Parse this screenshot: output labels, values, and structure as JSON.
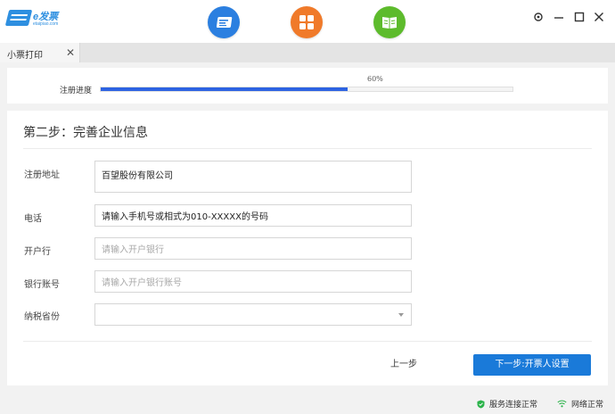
{
  "app": {
    "logo_text": "e发票",
    "logo_sub": "etaipiao.com",
    "icons": [
      "invoice-card-icon",
      "apps-grid-icon",
      "book-icon"
    ],
    "colors": {
      "accent": "#1a7ad9",
      "progress": "#2d63e2",
      "icon_blue": "#2b7fe0",
      "icon_orange": "#f07a2a",
      "icon_green": "#5dbb2c",
      "status_ok": "#2bb34a"
    }
  },
  "tabs": [
    {
      "label": "小票打印",
      "close": "✕"
    }
  ],
  "progress": {
    "label": "注册进度",
    "percent_text": "60%",
    "value": 0.6
  },
  "form": {
    "title": "第二步：完善企业信息",
    "fields": {
      "address": {
        "label": "注册地址",
        "value": "百望股份有限公司",
        "placeholder": ""
      },
      "phone": {
        "label": "电话",
        "value": "请输入手机号或相式为010-XXXXX的号码",
        "placeholder": ""
      },
      "bank": {
        "label": "开户行",
        "value": "",
        "placeholder": "请输入开户银行"
      },
      "account": {
        "label": "银行账号",
        "value": "",
        "placeholder": "请输入开户银行账号"
      },
      "province": {
        "label": "纳税省份",
        "value": "",
        "placeholder": ""
      }
    },
    "buttons": {
      "prev": "上一步",
      "next": "下一步:开票人设置"
    }
  },
  "status": {
    "service": "服务连接正常",
    "network": "网络正常"
  }
}
